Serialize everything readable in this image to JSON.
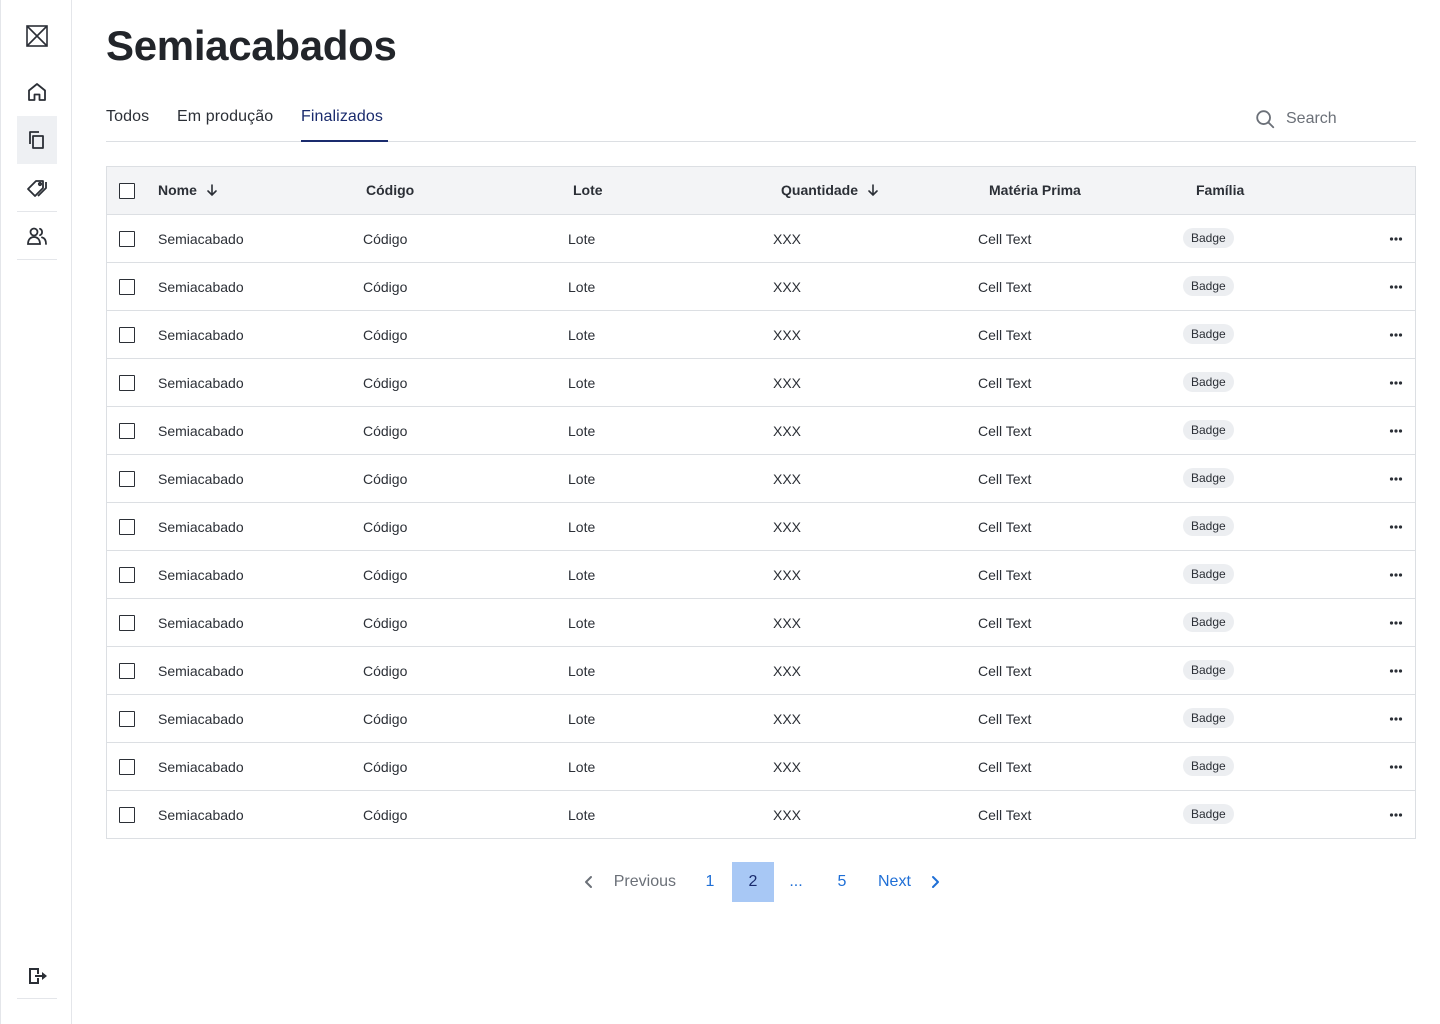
{
  "sidebar": {
    "items": [
      {
        "name": "logo-icon"
      },
      {
        "name": "home-icon"
      },
      {
        "name": "documents-icon"
      },
      {
        "name": "tags-icon"
      },
      {
        "name": "users-icon"
      },
      {
        "name": "logout-icon"
      }
    ],
    "active": "documents-icon"
  },
  "page": {
    "title": "Semiacabados"
  },
  "tabs": [
    {
      "label": "Todos"
    },
    {
      "label": "Em produção"
    },
    {
      "label": "Finalizados"
    }
  ],
  "active_tab": "Finalizados",
  "search": {
    "placeholder": "Search"
  },
  "table": {
    "headers": {
      "nome": "Nome",
      "codigo": "Código",
      "lote": "Lote",
      "quantidade": "Quantidade",
      "materia": "Matéria Prima",
      "familia": "Família"
    },
    "sorted_columns": [
      "Nome",
      "Quantidade"
    ],
    "rows": [
      {
        "nome": "Semiacabado",
        "codigo": "Código",
        "lote": "Lote",
        "quantidade": "XXX",
        "materia": "Cell Text",
        "familia": "Badge"
      },
      {
        "nome": "Semiacabado",
        "codigo": "Código",
        "lote": "Lote",
        "quantidade": "XXX",
        "materia": "Cell Text",
        "familia": "Badge"
      },
      {
        "nome": "Semiacabado",
        "codigo": "Código",
        "lote": "Lote",
        "quantidade": "XXX",
        "materia": "Cell Text",
        "familia": "Badge"
      },
      {
        "nome": "Semiacabado",
        "codigo": "Código",
        "lote": "Lote",
        "quantidade": "XXX",
        "materia": "Cell Text",
        "familia": "Badge"
      },
      {
        "nome": "Semiacabado",
        "codigo": "Código",
        "lote": "Lote",
        "quantidade": "XXX",
        "materia": "Cell Text",
        "familia": "Badge"
      },
      {
        "nome": "Semiacabado",
        "codigo": "Código",
        "lote": "Lote",
        "quantidade": "XXX",
        "materia": "Cell Text",
        "familia": "Badge"
      },
      {
        "nome": "Semiacabado",
        "codigo": "Código",
        "lote": "Lote",
        "quantidade": "XXX",
        "materia": "Cell Text",
        "familia": "Badge"
      },
      {
        "nome": "Semiacabado",
        "codigo": "Código",
        "lote": "Lote",
        "quantidade": "XXX",
        "materia": "Cell Text",
        "familia": "Badge"
      },
      {
        "nome": "Semiacabado",
        "codigo": "Código",
        "lote": "Lote",
        "quantidade": "XXX",
        "materia": "Cell Text",
        "familia": "Badge"
      },
      {
        "nome": "Semiacabado",
        "codigo": "Código",
        "lote": "Lote",
        "quantidade": "XXX",
        "materia": "Cell Text",
        "familia": "Badge"
      },
      {
        "nome": "Semiacabado",
        "codigo": "Código",
        "lote": "Lote",
        "quantidade": "XXX",
        "materia": "Cell Text",
        "familia": "Badge"
      },
      {
        "nome": "Semiacabado",
        "codigo": "Código",
        "lote": "Lote",
        "quantidade": "XXX",
        "materia": "Cell Text",
        "familia": "Badge"
      },
      {
        "nome": "Semiacabado",
        "codigo": "Código",
        "lote": "Lote",
        "quantidade": "XXX",
        "materia": "Cell Text",
        "familia": "Badge"
      }
    ]
  },
  "pagination": {
    "previous": "Previous",
    "pages": [
      "1",
      "2",
      "...",
      "5"
    ],
    "current": "2",
    "next": "Next"
  },
  "colors": {
    "accent": "#1a2b6d",
    "link": "#1f6fd6",
    "current_page_bg": "#a8c8f5"
  }
}
